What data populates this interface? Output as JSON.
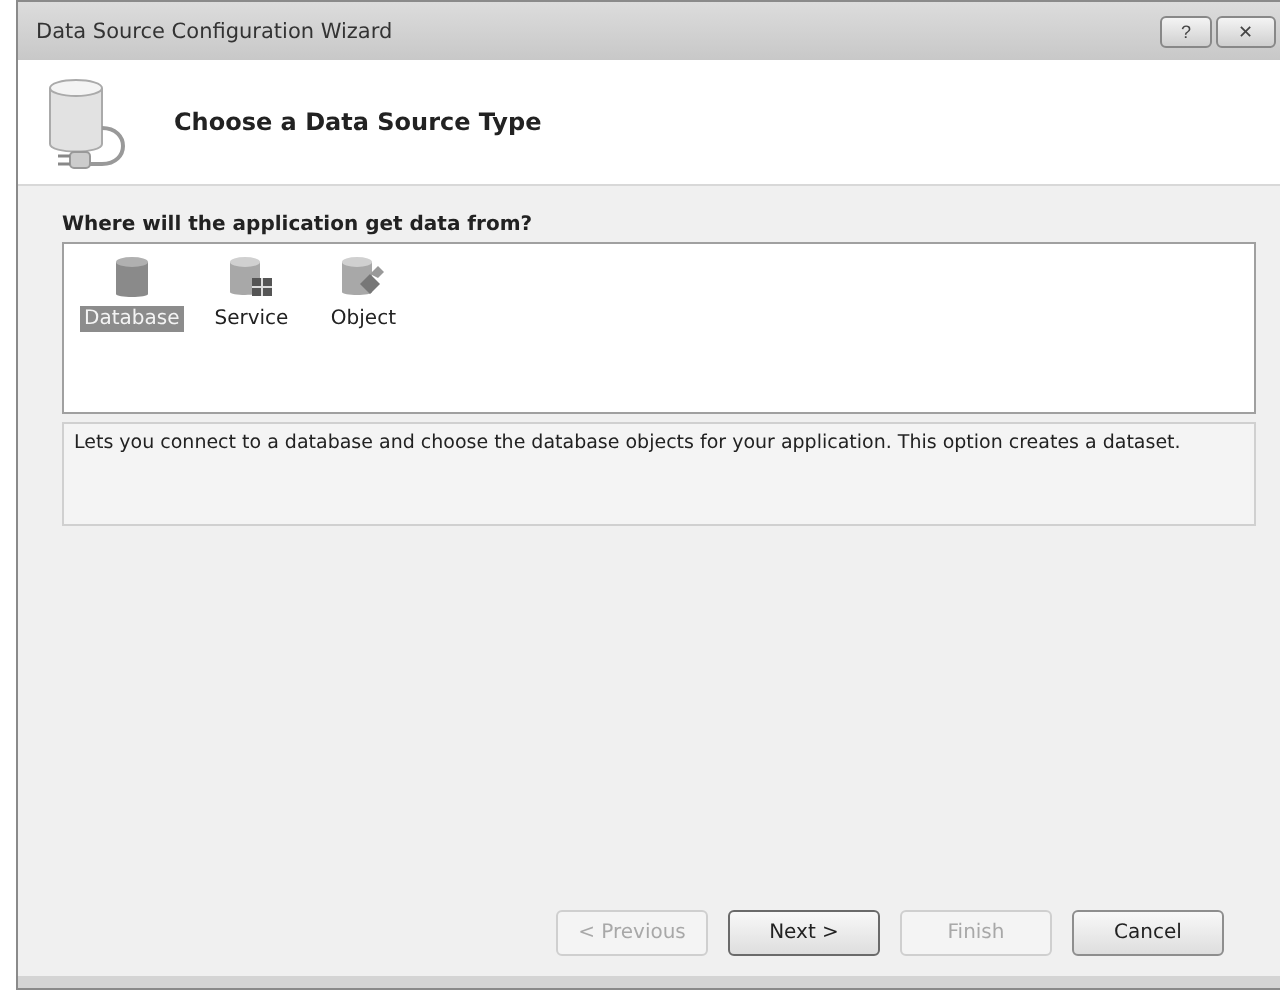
{
  "window": {
    "title": "Data Source Configuration Wizard",
    "buttons": [
      {
        "kind": "help",
        "label": "?"
      },
      {
        "kind": "close",
        "label": "✕"
      }
    ]
  },
  "header": {
    "title": "Choose a Data Source Type"
  },
  "prompt": "Where will the application get data from?",
  "options": [
    {
      "kind": "database",
      "label": "Database",
      "selected": true
    },
    {
      "kind": "service",
      "label": "Service",
      "selected": false
    },
    {
      "kind": "object",
      "label": "Object",
      "selected": false
    }
  ],
  "description": "Lets you connect to a database and choose the database objects for your application. This option creates a dataset.",
  "buttons": [
    {
      "label": "< Previous",
      "disabled": true,
      "default": false
    },
    {
      "label": "Next >",
      "disabled": false,
      "default": true
    },
    {
      "label": "Finish",
      "disabled": true,
      "default": false
    },
    {
      "label": "Cancel",
      "disabled": false,
      "default": false
    }
  ]
}
